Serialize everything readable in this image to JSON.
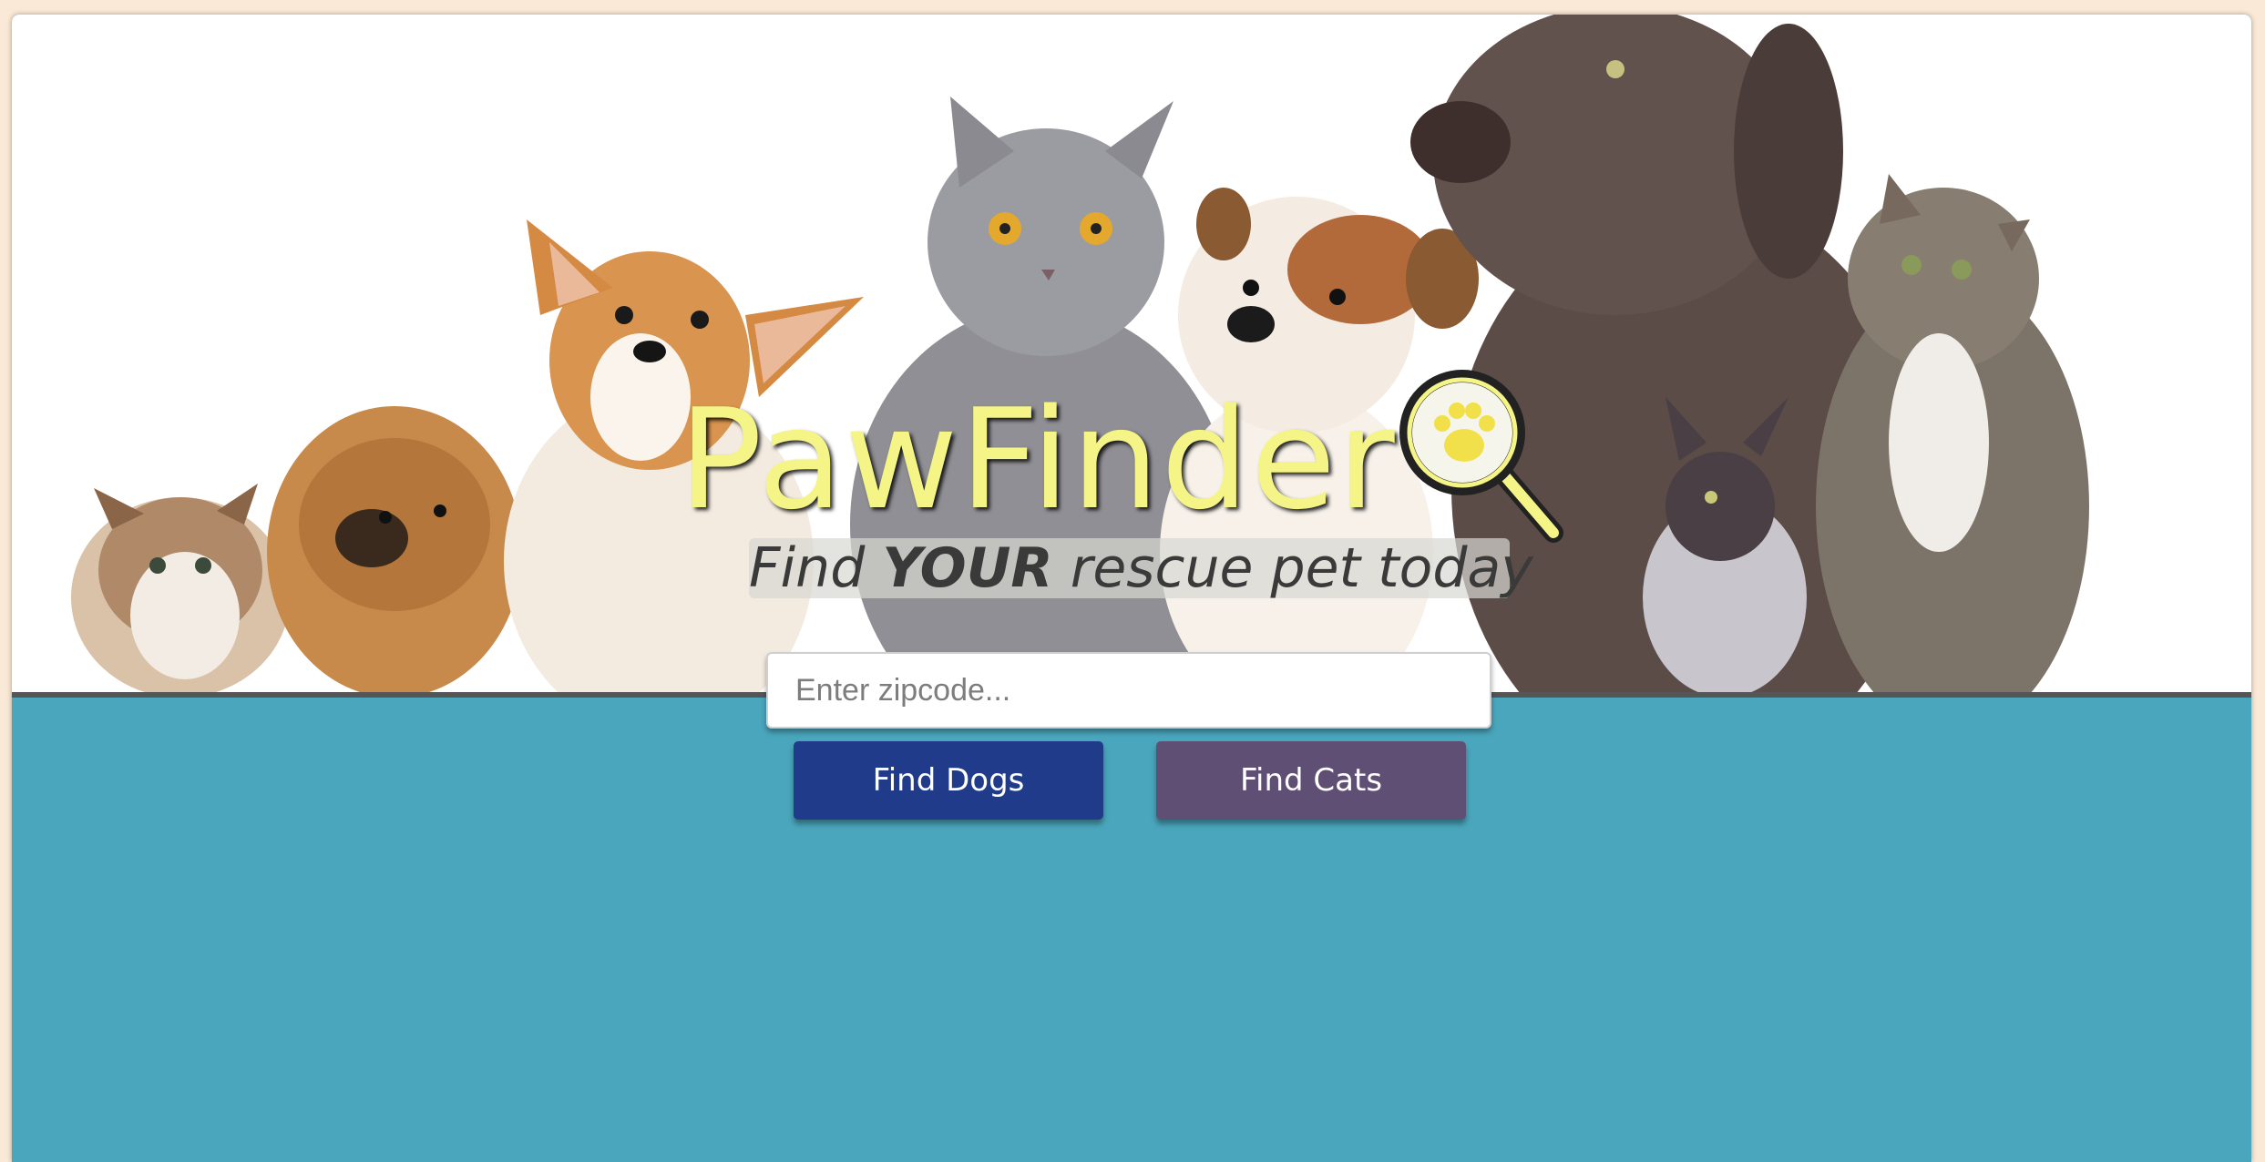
{
  "brand": {
    "logo_text": "PawFinder",
    "tagline_pre": "Find ",
    "tagline_bold": "YOUR",
    "tagline_post": " rescue pet today",
    "logo_color": "#f5f587"
  },
  "search": {
    "placeholder": "Enter zipcode...",
    "value": ""
  },
  "actions": {
    "find_dogs_label": "Find Dogs",
    "find_cats_label": "Find Cats"
  },
  "colors": {
    "page_background": "#fbe9d7",
    "lower_panel": "#4aa6bc",
    "dogs_button": "#1f3b8a",
    "cats_button": "#5f4f75"
  },
  "hero_image": {
    "icon": "pets-group-photo"
  }
}
